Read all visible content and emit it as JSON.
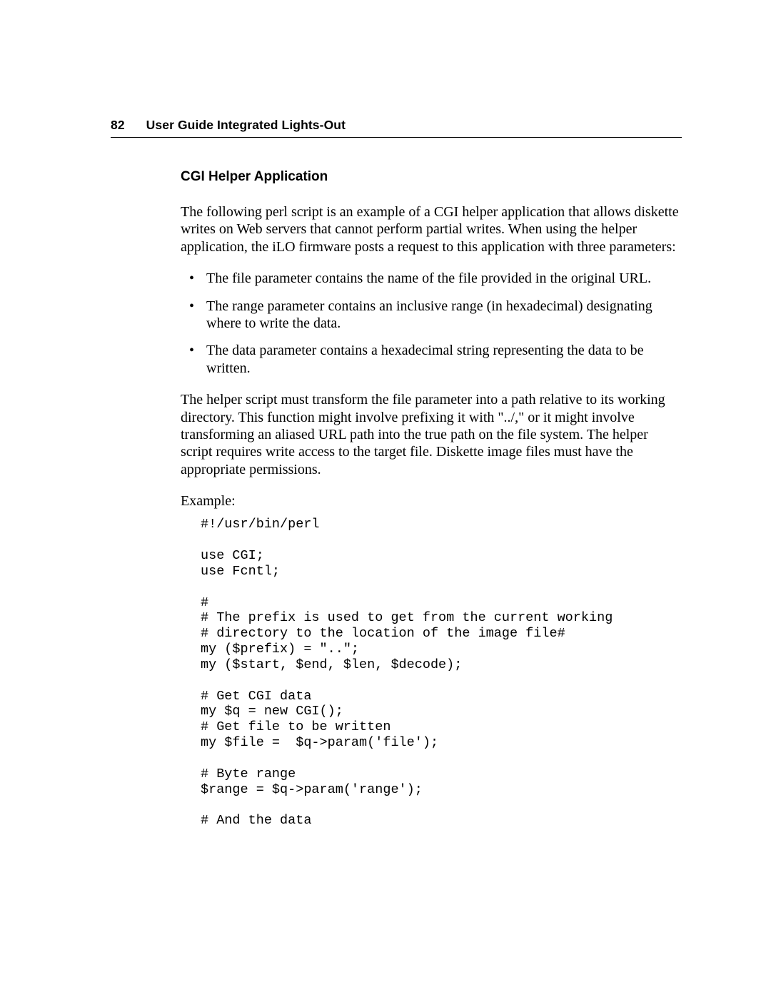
{
  "header": {
    "page_number": "82",
    "title": "User Guide Integrated Lights-Out"
  },
  "section_heading": "CGI Helper Application",
  "intro_paragraph": "The following perl script is an example of a CGI helper application that allows diskette writes on Web servers that cannot perform partial writes. When using the helper application, the iLO firmware posts a request to this application with three parameters:",
  "bullets": [
    "The file parameter contains the name of the file provided in the original URL.",
    "The range parameter contains an inclusive range (in hexadecimal) designating where to write the data.",
    "The data parameter contains a hexadecimal string representing the data to be written."
  ],
  "middle_paragraph": "The helper script must transform the file parameter into a path relative to its working directory. This function might involve prefixing it with \"../,\" or it might involve transforming an aliased URL path into the true path on the file system. The helper script requires write access to the target file. Diskette image files must have the appropriate permissions.",
  "example_label": "Example:",
  "code": "#!/usr/bin/perl\n\nuse CGI;\nuse Fcntl;\n\n#\n# The prefix is used to get from the current working\n# directory to the location of the image file#\nmy ($prefix) = \"..\";\nmy ($start, $end, $len, $decode);\n\n# Get CGI data\nmy $q = new CGI();\n# Get file to be written\nmy $file =  $q->param('file');\n\n# Byte range\n$range = $q->param('range');\n\n# And the data"
}
